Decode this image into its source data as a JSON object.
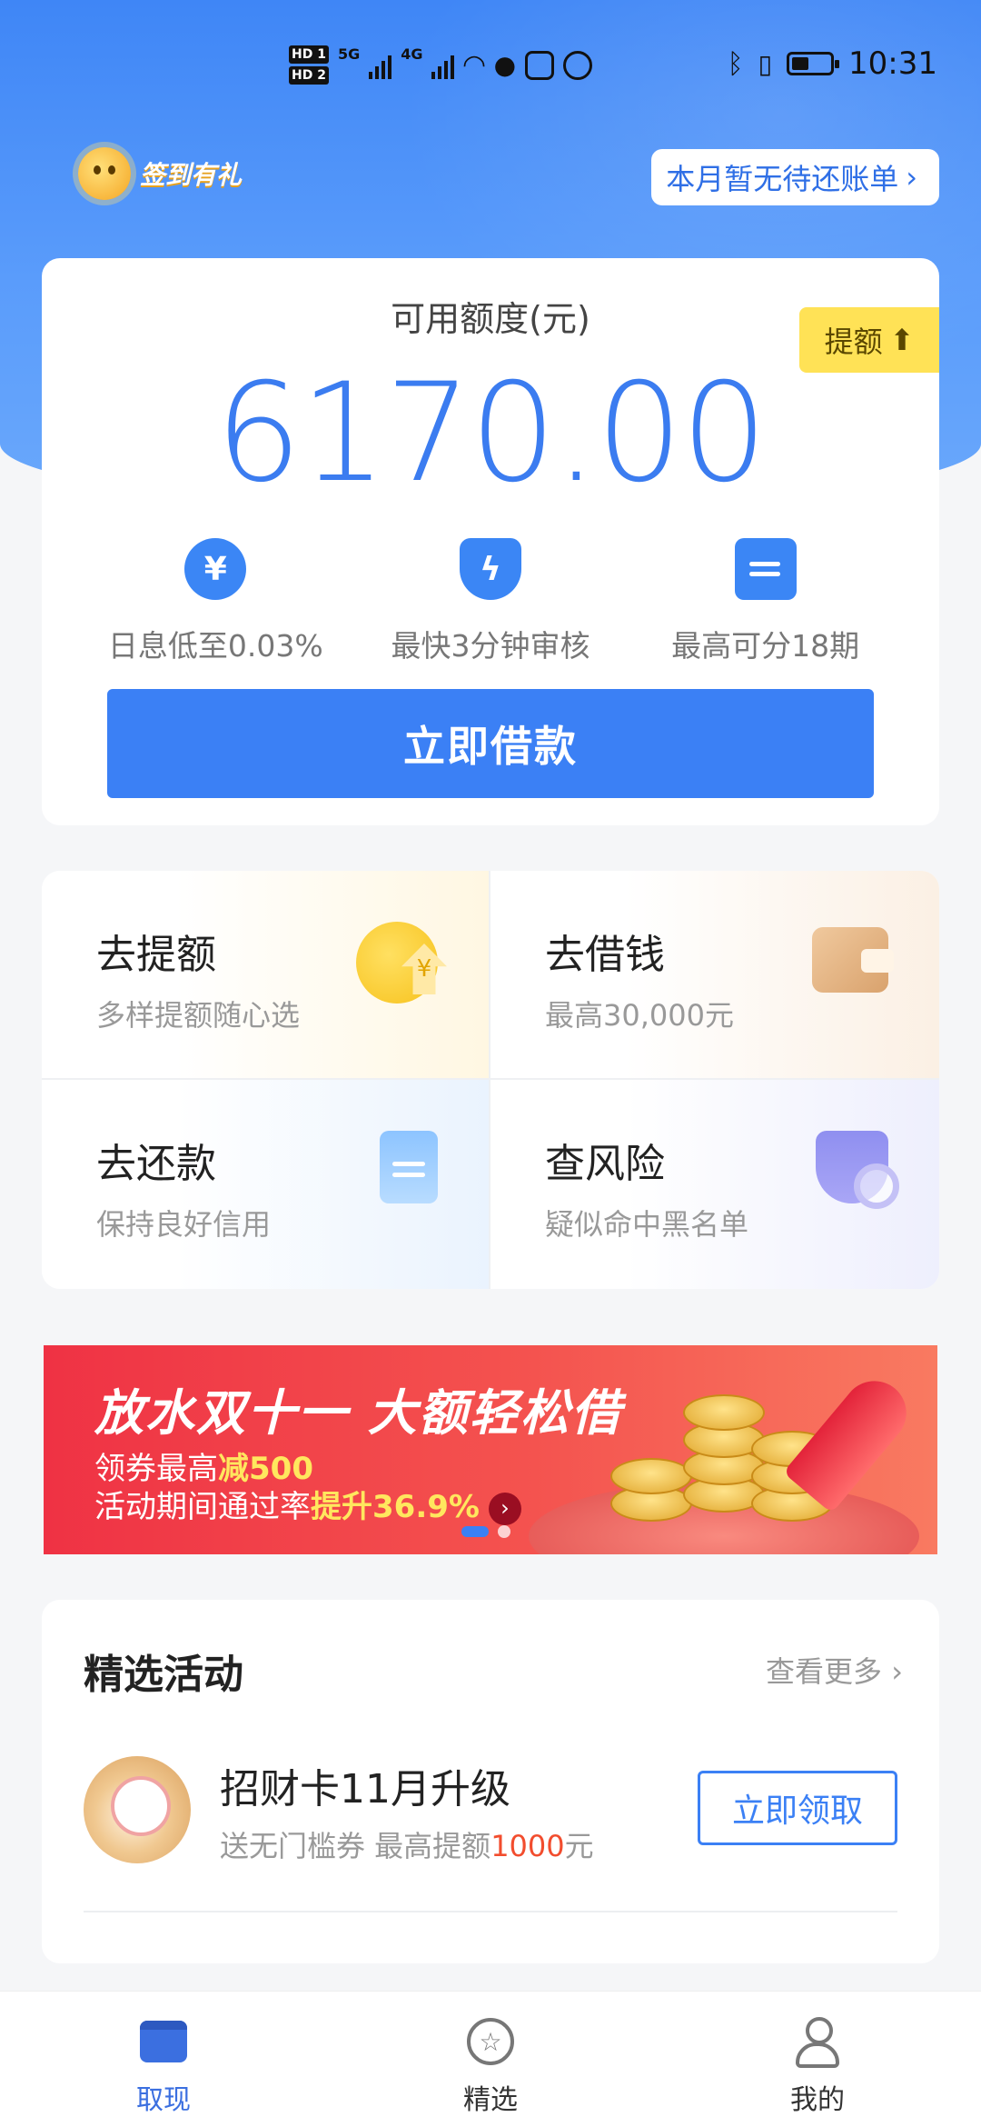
{
  "status_bar": {
    "time": "10:31",
    "network_5g": "5G",
    "network_4g": "4G",
    "hd1": "HD 1",
    "hd2": "HD 2",
    "icons": [
      "signal-icon",
      "wifi-icon",
      "wechat-icon",
      "app-icon",
      "bulb-icon",
      "bluetooth-icon",
      "vibrate-icon",
      "battery-icon"
    ]
  },
  "header": {
    "signin_label": "签到有礼",
    "bill_notice": "本月暂无待还账单"
  },
  "credit": {
    "title": "可用额度(元)",
    "amount": "6170.00",
    "raise_label": "提额",
    "features": [
      {
        "icon": "yuan-icon",
        "label": "日息低至0.03%"
      },
      {
        "icon": "lightning-shield-icon",
        "label": "最快3分钟审核"
      },
      {
        "icon": "calendar-icon",
        "label": "最高可分18期"
      }
    ],
    "borrow_button": "立即借款"
  },
  "services": [
    {
      "title": "去提额",
      "subtitle": "多样提额随心选",
      "icon": "coin-up-icon"
    },
    {
      "title": "去借钱",
      "subtitle": "最高30,000元",
      "icon": "wallet-icon"
    },
    {
      "title": "去还款",
      "subtitle": "保持良好信用",
      "icon": "document-icon"
    },
    {
      "title": "查风险",
      "subtitle": "疑似命中黑名单",
      "icon": "shield-search-icon"
    }
  ],
  "banner": {
    "title": "放水双十一 大额轻松借",
    "line1_prefix": "领券最高",
    "line1_highlight": "减500",
    "line2_prefix": "活动期间通过率",
    "line2_highlight": "提升36.9%",
    "page_count": 2,
    "active_page": 1
  },
  "activities": {
    "title": "精选活动",
    "more": "查看更多",
    "items": [
      {
        "title": "招财卡11月升级",
        "sub_prefix": "送无门槛券 最高提额",
        "sub_amount": "1000",
        "sub_suffix": "元",
        "button": "立即领取"
      }
    ]
  },
  "tabbar": {
    "items": [
      {
        "label": "取现",
        "icon": "wallet-icon",
        "active": true
      },
      {
        "label": "精选",
        "icon": "star-icon",
        "active": false
      },
      {
        "label": "我的",
        "icon": "user-icon",
        "active": false
      }
    ]
  },
  "colors": {
    "primary": "#3b80f5",
    "banner_red": "#ef3244",
    "highlight_yellow": "#ffe256",
    "accent_red": "#f24d2e"
  }
}
